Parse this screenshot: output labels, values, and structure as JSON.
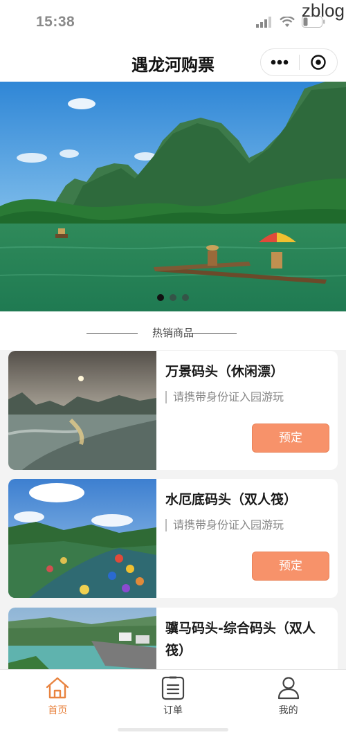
{
  "status_bar": {
    "time": "15:38",
    "icons": [
      "signal-icon",
      "wifi-icon",
      "battery-icon"
    ]
  },
  "watermark": "zblog",
  "nav": {
    "title": "遇龙河购票",
    "capsule_icons": [
      "more-dots-icon",
      "close-target-icon"
    ]
  },
  "banner": {
    "slide_count": 3,
    "active_slide": 1
  },
  "section": {
    "title": "热销商品"
  },
  "products": [
    {
      "name": "万景码头（休闲漂）",
      "tip": "请携带身份证入园游玩",
      "button": "预定"
    },
    {
      "name": "水厄底码头（双人筏）",
      "tip": "请携带身份证入园游玩",
      "button": "预定"
    },
    {
      "name": "骥马码头-综合码头（双人筏）",
      "tip": "",
      "button": ""
    }
  ],
  "tabbar": {
    "items": [
      {
        "label": "首页",
        "icon": "home-icon",
        "active": true
      },
      {
        "label": "订单",
        "icon": "order-list-icon",
        "active": false
      },
      {
        "label": "我的",
        "icon": "user-icon",
        "active": false
      }
    ]
  },
  "colors": {
    "accent": "#f7926a",
    "tab_active": "#e8833f"
  }
}
